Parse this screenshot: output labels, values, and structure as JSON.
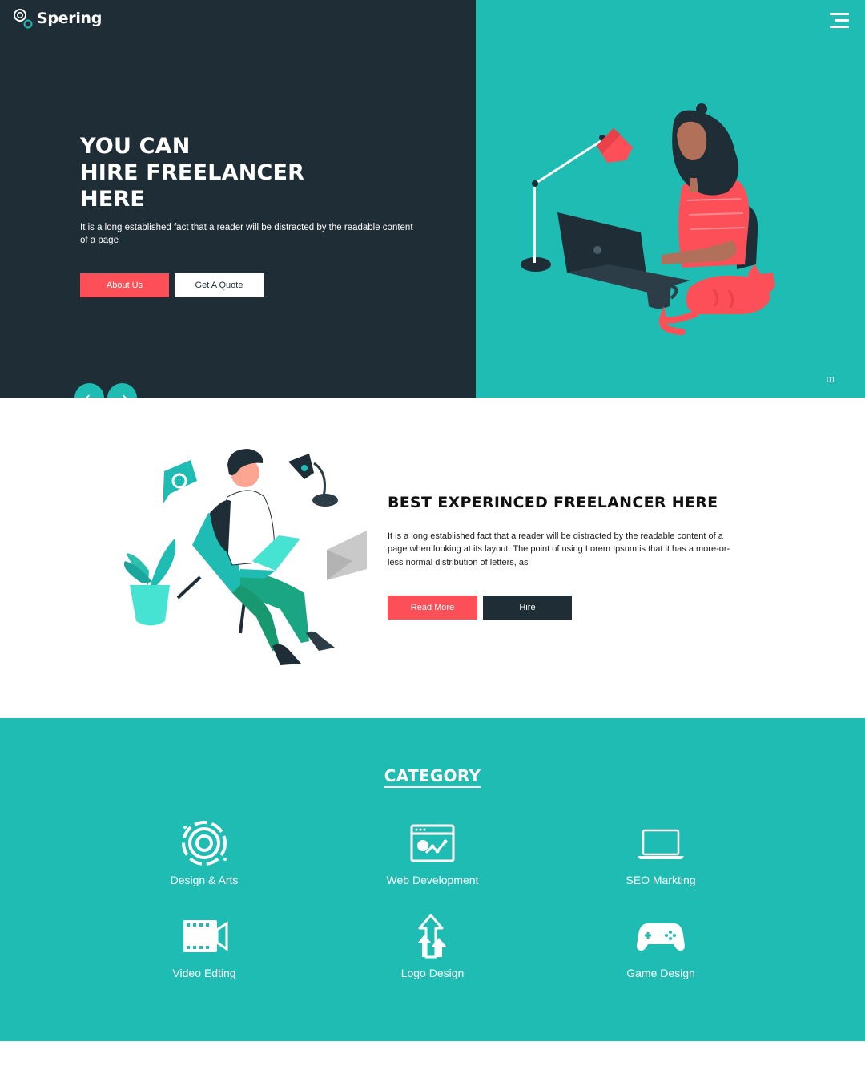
{
  "brand": {
    "name": "Spering"
  },
  "hero": {
    "title_lines": [
      "YOU CAN",
      "HIRE FREELANCER",
      "HERE"
    ],
    "text": "It is a long established fact that a reader will be distracted by the readable content of a page",
    "about_button": "About Us",
    "quote_button": "Get A Quote",
    "slide_number": "01"
  },
  "about": {
    "title": "BEST EXPERINCED FREELANCER HERE",
    "text": "It is a long established fact that a reader will be distracted by the readable content of a page when looking at its layout. The point of using Lorem Ipsum is that it has a more-or-less normal distribution of letters, as",
    "read_more_button": "Read More",
    "hire_button": "Hire"
  },
  "category": {
    "title": "CATEGORY",
    "items": [
      {
        "label": "Design & Arts",
        "icon": "palette-icon"
      },
      {
        "label": "Web Development",
        "icon": "web-analytics-icon"
      },
      {
        "label": "SEO Markting",
        "icon": "laptop-icon"
      },
      {
        "label": "Video Edting",
        "icon": "video-camera-icon"
      },
      {
        "label": "Logo Design",
        "icon": "arrows-up-icon"
      },
      {
        "label": "Game Design",
        "icon": "gamepad-icon"
      }
    ]
  },
  "colors": {
    "dark": "#1f2d36",
    "teal": "#1ebcb3",
    "red": "#fc4f58",
    "white": "#ffffff"
  }
}
